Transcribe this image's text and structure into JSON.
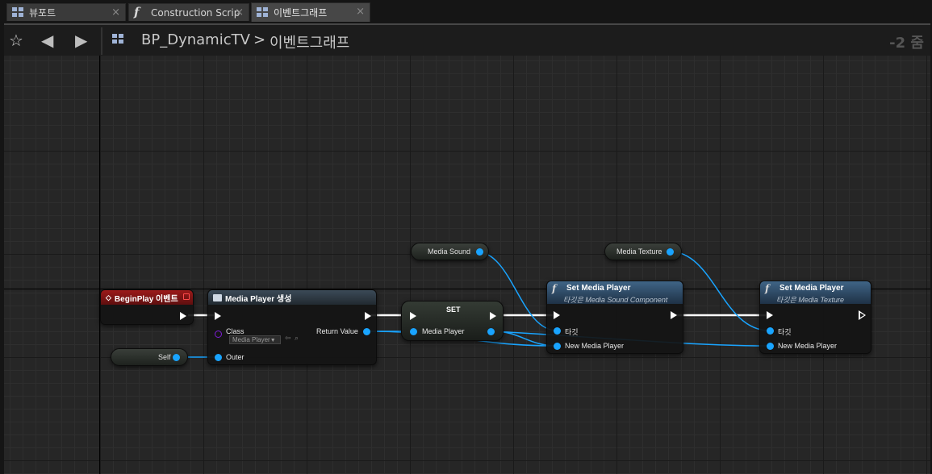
{
  "tabs": [
    {
      "label": "뷰포트",
      "icon": "viewport-grid-icon",
      "close": "×"
    },
    {
      "label": "Construction Scrip",
      "icon": "function-icon",
      "close": "×"
    },
    {
      "label": "이벤트그래프",
      "icon": "event-graph-icon",
      "close": "×"
    }
  ],
  "breadcrumb": {
    "blueprint": "BP_DynamicTV",
    "separator": ">",
    "graph": "이벤트그래프",
    "zoom": "-2 줌"
  },
  "nodes": {
    "begin_play": {
      "title": "BeginPlay 이벤트"
    },
    "media_player_create": {
      "title": "Media Player 생성",
      "class_label": "Class",
      "class_value": "Media Player",
      "return_label": "Return Value",
      "outer_label": "Outer"
    },
    "self_var": {
      "label": "Self"
    },
    "set_node": {
      "title": "SET",
      "pin_label": "Media Player"
    },
    "media_sound_var": {
      "label": "Media Sound"
    },
    "media_texture_var": {
      "label": "Media Texture"
    },
    "set_media_player_1": {
      "title": "Set Media Player",
      "subtitle": "타깃은 Media Sound Component",
      "target_label": "타깃",
      "new_player_label": "New Media Player"
    },
    "set_media_player_2": {
      "title": "Set Media Player",
      "subtitle": "타깃은 Media Texture",
      "target_label": "타깃",
      "new_player_label": "New Media Player"
    }
  },
  "colors": {
    "event_header": "#7a1414",
    "function_header": "#2c4a64",
    "object_pin": "#19a4ff",
    "class_pin": "#7e1cd8",
    "exec_wire": "#ffffff"
  }
}
